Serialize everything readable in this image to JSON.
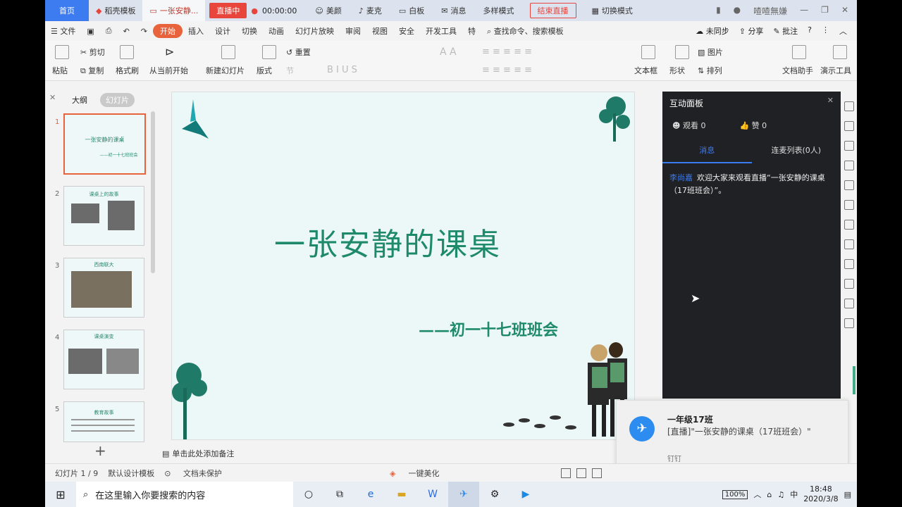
{
  "tabbar": {
    "home": "首页",
    "template": "稻壳模板",
    "doc": "一张安静...",
    "live": "直播中",
    "timer": "00:00:00",
    "beauty": "美颜",
    "mic": "麦克",
    "board": "白板",
    "message": "消息",
    "multi": "多样模式",
    "end": "结束直播",
    "switch": "切换模式",
    "user": "喳喳無嫌"
  },
  "menu": {
    "file": "文件",
    "items": [
      "开始",
      "插入",
      "设计",
      "切换",
      "动画",
      "幻灯片放映",
      "审阅",
      "视图",
      "安全",
      "开发工具",
      "特"
    ],
    "search": "查找命令、搜索模板",
    "sync": "未同步",
    "share": "分享",
    "comment": "批注"
  },
  "ribbon": {
    "paste": "粘贴",
    "cut": "剪切",
    "copy": "复制",
    "format": "格式刷",
    "from_current": "从当前开始",
    "new_slide": "新建幻灯片",
    "layout": "版式",
    "reset": "重置",
    "section": "节",
    "textbox": "文本框",
    "shape": "形状",
    "picture": "图片",
    "arrange": "排列",
    "assistant": "文档助手",
    "present": "演示工具"
  },
  "pane": {
    "outline": "大纲",
    "slides": "幻灯片",
    "numbers": [
      "1",
      "2",
      "3",
      "4",
      "5"
    ],
    "t1_title": "一张安静的课桌",
    "t1_sub": "——初一十七班班会",
    "t2_cap": "课桌上的故事",
    "t3_cap": "西南联大",
    "t4_cap": "课桌演变",
    "t5_cap": "教育故事"
  },
  "slide": {
    "title": "一张安静的课桌",
    "subtitle": "——初一十七班班会",
    "notes": "单击此处添加备注"
  },
  "panel": {
    "title": "互动面板",
    "viewers": "观看 0",
    "likes": "赞 0",
    "tab_msg": "消息",
    "tab_mic": "连麦列表(0人)",
    "user": "李尚嘉",
    "message": "欢迎大家来观看直播“一张安静的课桌（17班班会）”。"
  },
  "notification": {
    "title": "一年级17班",
    "body": "[直播]\"一张安静的课桌（17班班会）\"",
    "app": "钉钉"
  },
  "status": {
    "slide": "幻灯片 1 / 9",
    "template": "默认设计模板",
    "protect": "文档未保护",
    "beautify": "一键美化"
  },
  "taskbar": {
    "search": "在这里输入你要搜索的内容",
    "battery": "100%",
    "time": "18:48",
    "date": "2020/3/8"
  }
}
